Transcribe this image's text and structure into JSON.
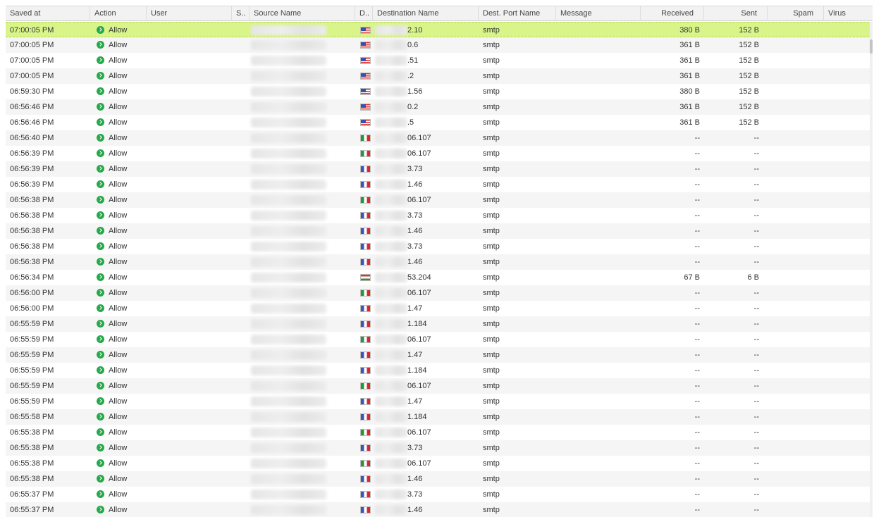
{
  "columns": [
    {
      "key": "saved_at",
      "label": "Saved at"
    },
    {
      "key": "action",
      "label": "Action"
    },
    {
      "key": "user",
      "label": "User"
    },
    {
      "key": "s",
      "label": "S.."
    },
    {
      "key": "source_name",
      "label": "Source Name"
    },
    {
      "key": "d",
      "label": "D.."
    },
    {
      "key": "destination_name",
      "label": "Destination Name"
    },
    {
      "key": "dest_port_name",
      "label": "Dest. Port Name"
    },
    {
      "key": "message",
      "label": "Message"
    },
    {
      "key": "received",
      "label": "Received"
    },
    {
      "key": "sent",
      "label": "Sent"
    },
    {
      "key": "spam",
      "label": "Spam"
    },
    {
      "key": "virus",
      "label": "Virus"
    }
  ],
  "action_label": "Allow",
  "colors": {
    "selected_row": "#d9f58a",
    "allow_icon": "#27a84a",
    "header_bg": "#f2f2f2",
    "alt_row": "#f5f5f5"
  },
  "rows": [
    {
      "time": "07:00:05 PM",
      "flag": "us",
      "dest": "2.10",
      "port": "smtp",
      "received": "380 B",
      "sent": "152 B",
      "selected": true
    },
    {
      "time": "07:00:05 PM",
      "flag": "us",
      "dest": "0.6",
      "port": "smtp",
      "received": "361 B",
      "sent": "152 B"
    },
    {
      "time": "07:00:05 PM",
      "flag": "us",
      "dest": ".51",
      "port": "smtp",
      "received": "361 B",
      "sent": "152 B"
    },
    {
      "time": "07:00:05 PM",
      "flag": "us",
      "dest": ".2",
      "port": "smtp",
      "received": "361 B",
      "sent": "152 B"
    },
    {
      "time": "06:59:30 PM",
      "flag": "us",
      "dest": "1.56",
      "port": "smtp",
      "received": "380 B",
      "sent": "152 B"
    },
    {
      "time": "06:56:46 PM",
      "flag": "us",
      "dest": "0.2",
      "port": "smtp",
      "received": "361 B",
      "sent": "152 B"
    },
    {
      "time": "06:56:46 PM",
      "flag": "us",
      "dest": ".5",
      "port": "smtp",
      "received": "361 B",
      "sent": "152 B"
    },
    {
      "time": "06:56:40 PM",
      "flag": "it",
      "dest": "06.107",
      "port": "smtp",
      "received": "--",
      "sent": "--"
    },
    {
      "time": "06:56:39 PM",
      "flag": "it",
      "dest": "06.107",
      "port": "smtp",
      "received": "--",
      "sent": "--"
    },
    {
      "time": "06:56:39 PM",
      "flag": "fr",
      "dest": "3.73",
      "port": "smtp",
      "received": "--",
      "sent": "--"
    },
    {
      "time": "06:56:39 PM",
      "flag": "fr",
      "dest": "1.46",
      "port": "smtp",
      "received": "--",
      "sent": "--"
    },
    {
      "time": "06:56:38 PM",
      "flag": "it",
      "dest": "06.107",
      "port": "smtp",
      "received": "--",
      "sent": "--"
    },
    {
      "time": "06:56:38 PM",
      "flag": "fr",
      "dest": "3.73",
      "port": "smtp",
      "received": "--",
      "sent": "--"
    },
    {
      "time": "06:56:38 PM",
      "flag": "fr",
      "dest": "1.46",
      "port": "smtp",
      "received": "--",
      "sent": "--"
    },
    {
      "time": "06:56:38 PM",
      "flag": "fr",
      "dest": "3.73",
      "port": "smtp",
      "received": "--",
      "sent": "--"
    },
    {
      "time": "06:56:38 PM",
      "flag": "fr",
      "dest": "1.46",
      "port": "smtp",
      "received": "--",
      "sent": "--"
    },
    {
      "time": "06:56:34 PM",
      "flag": "hu",
      "dest": "53.204",
      "port": "smtp",
      "received": "67 B",
      "sent": "6 B"
    },
    {
      "time": "06:56:00 PM",
      "flag": "it",
      "dest": "06.107",
      "port": "smtp",
      "received": "--",
      "sent": "--"
    },
    {
      "time": "06:56:00 PM",
      "flag": "fr",
      "dest": "1.47",
      "port": "smtp",
      "received": "--",
      "sent": "--"
    },
    {
      "time": "06:55:59 PM",
      "flag": "fr",
      "dest": "1.184",
      "port": "smtp",
      "received": "--",
      "sent": "--"
    },
    {
      "time": "06:55:59 PM",
      "flag": "it",
      "dest": "06.107",
      "port": "smtp",
      "received": "--",
      "sent": "--"
    },
    {
      "time": "06:55:59 PM",
      "flag": "fr",
      "dest": "1.47",
      "port": "smtp",
      "received": "--",
      "sent": "--"
    },
    {
      "time": "06:55:59 PM",
      "flag": "fr",
      "dest": "1.184",
      "port": "smtp",
      "received": "--",
      "sent": "--"
    },
    {
      "time": "06:55:59 PM",
      "flag": "it",
      "dest": "06.107",
      "port": "smtp",
      "received": "--",
      "sent": "--"
    },
    {
      "time": "06:55:59 PM",
      "flag": "fr",
      "dest": "1.47",
      "port": "smtp",
      "received": "--",
      "sent": "--"
    },
    {
      "time": "06:55:58 PM",
      "flag": "fr",
      "dest": "1.184",
      "port": "smtp",
      "received": "--",
      "sent": "--"
    },
    {
      "time": "06:55:38 PM",
      "flag": "it",
      "dest": "06.107",
      "port": "smtp",
      "received": "--",
      "sent": "--"
    },
    {
      "time": "06:55:38 PM",
      "flag": "fr",
      "dest": "3.73",
      "port": "smtp",
      "received": "--",
      "sent": "--"
    },
    {
      "time": "06:55:38 PM",
      "flag": "it",
      "dest": "06.107",
      "port": "smtp",
      "received": "--",
      "sent": "--"
    },
    {
      "time": "06:55:38 PM",
      "flag": "fr",
      "dest": "1.46",
      "port": "smtp",
      "received": "--",
      "sent": "--"
    },
    {
      "time": "06:55:37 PM",
      "flag": "fr",
      "dest": "3.73",
      "port": "smtp",
      "received": "--",
      "sent": "--"
    },
    {
      "time": "06:55:37 PM",
      "flag": "fr",
      "dest": "1.46",
      "port": "smtp",
      "received": "--",
      "sent": "--"
    }
  ]
}
